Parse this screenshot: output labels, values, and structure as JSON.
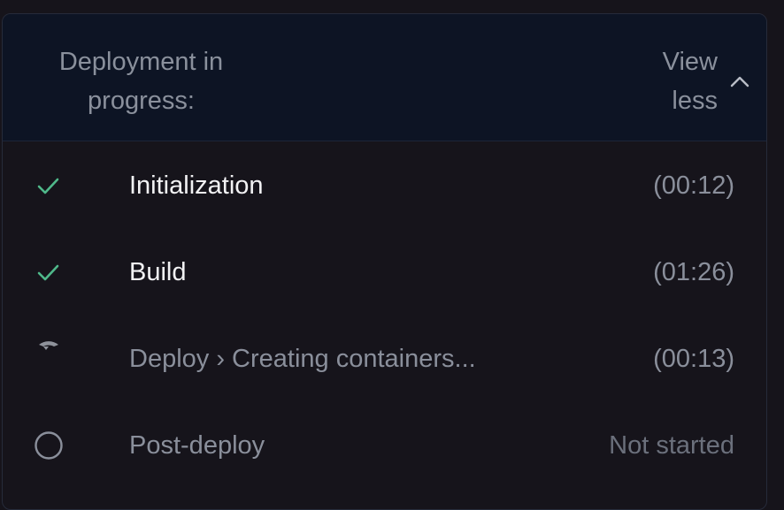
{
  "header": {
    "title": "Deployment in\nprogress:",
    "toggle_line1": "View",
    "toggle_line2": "less",
    "toggle_icon": "chevron-up-icon"
  },
  "colors": {
    "success": "#4fb88a",
    "muted": "#8a8f9b",
    "header_bg": "#0d1424",
    "panel_bg": "#16141b"
  },
  "steps": [
    {
      "label": "Initialization",
      "time": "(00:12)",
      "status": "done",
      "icon": "check-icon"
    },
    {
      "label": "Build",
      "time": "(01:26)",
      "status": "done",
      "icon": "check-icon"
    },
    {
      "label": "Deploy › Creating containers...",
      "time": "(00:13)",
      "status": "in-progress",
      "icon": "spinner-icon"
    },
    {
      "label": "Post-deploy",
      "time": "Not started",
      "status": "pending",
      "icon": "circle-icon"
    }
  ]
}
